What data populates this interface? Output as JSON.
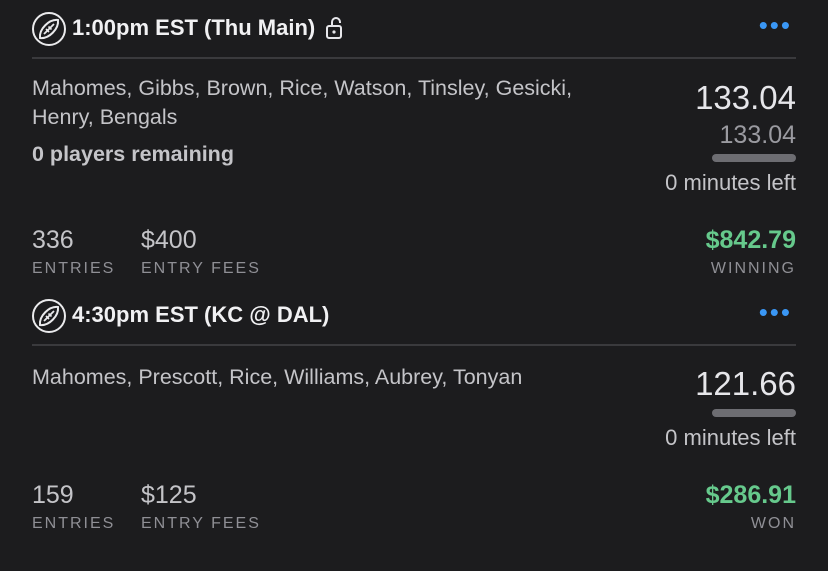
{
  "entries": [
    {
      "title": "1:00pm EST (Thu Main)",
      "players": "Mahomes, Gibbs, Brown, Rice, Watson, Tinsley, Gesicki, Henry, Bengals",
      "remaining": "0 players remaining",
      "score": "133.04",
      "projected": "133.04",
      "progress": 1.0,
      "time_left": "0 minutes left",
      "entries_count": "336",
      "entries_label": "ENTRIES",
      "fees": "$400",
      "fees_label": "ENTRY FEES",
      "winnings": "$842.79",
      "winnings_label": "WINNING"
    },
    {
      "title": "4:30pm EST (KC @ DAL)",
      "players": "Mahomes, Prescott, Rice, Williams, Aubrey, Tonyan",
      "score": "121.66",
      "progress": 1.0,
      "time_left": "0 minutes left",
      "entries_count": "159",
      "entries_label": "ENTRIES",
      "fees": "$125",
      "fees_label": "ENTRY FEES",
      "winnings": "$286.91",
      "winnings_label": "WON"
    }
  ],
  "more_glyph": "•••",
  "colors": {
    "background": "#1c1c1e",
    "accent": "#3a97f5",
    "winnings": "#66c98c",
    "divider": "#3a3a3d"
  },
  "icons": {
    "sport": "football-icon",
    "lock": "unlock-icon",
    "menu": "more-icon"
  }
}
